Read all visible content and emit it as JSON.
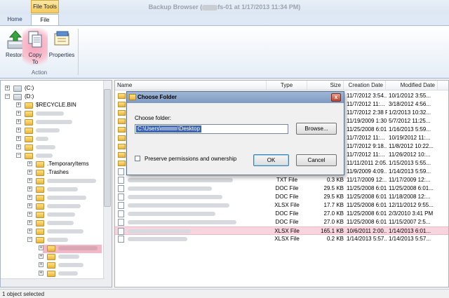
{
  "ribbon": {
    "context_tab": "File Tools",
    "window_title_prefix": "Backup Browser (",
    "window_title_suffix": "fs-01 at 1/17/2013 11:34 PM)",
    "tabs": [
      "Home",
      "File"
    ],
    "buttons": [
      {
        "label": "Restore",
        "icon": "restore-icon"
      },
      {
        "label_line1": "Copy",
        "label_line2": "To",
        "icon": "copy-to-icon"
      },
      {
        "label": "Properties",
        "icon": "properties-icon"
      }
    ],
    "group_label": "Action"
  },
  "tree": {
    "items": [
      {
        "label": "(C:)"
      },
      {
        "label": "(D:)"
      },
      {
        "label": "$RECYCLE.BIN"
      },
      {
        "label": ".TemporaryItems"
      },
      {
        "label": ".Trashes"
      }
    ]
  },
  "list": {
    "columns": [
      "Name",
      "Type",
      "Size",
      "Creation Date",
      "Modified Date"
    ],
    "rows": [
      {
        "type": "",
        "size": "",
        "created": "11/7/2012 3:54...",
        "modified": "10/1/2012 3:55..."
      },
      {
        "type": "",
        "size": "",
        "created": "11/7/2012 11:...",
        "modified": "3/18/2012 4:56..."
      },
      {
        "type": "",
        "size": "",
        "created": "11/7/2012 2:38 PM",
        "modified": "1/2/2013 10:32..."
      },
      {
        "type": "",
        "size": "",
        "created": "11/19/2009 1:30 PM",
        "modified": "5/7/2012 11:25..."
      },
      {
        "type": "",
        "size": "",
        "created": "11/25/2008 6:01...",
        "modified": "1/16/2013 5:59..."
      },
      {
        "type": "",
        "size": "",
        "created": "11/7/2012 11:...",
        "modified": "10/19/2012 11:..."
      },
      {
        "type": "",
        "size": "",
        "created": "11/7/2012 9:18...",
        "modified": "11/8/2012 10:22..."
      },
      {
        "type": "",
        "size": "",
        "created": "11/7/2012 11:...",
        "modified": "11/26/2012 10:..."
      },
      {
        "type": "",
        "size": "",
        "created": "11/11/2011 2:05...",
        "modified": "1/15/2013 5:55..."
      },
      {
        "type": "TXT File",
        "size": "1.5 KB",
        "created": "11/9/2009 4:09...",
        "modified": "1/14/2013 5:59..."
      },
      {
        "type": "TXT File",
        "size": "0.3 KB",
        "created": "11/17/2009 12:...",
        "modified": "11/17/2009 12:..."
      },
      {
        "type": "DOC File",
        "size": "29.5 KB",
        "created": "11/25/2008 6:01...",
        "modified": "11/25/2008 6:01..."
      },
      {
        "type": "DOC File",
        "size": "29.5 KB",
        "created": "11/25/2008 6:01...",
        "modified": "11/18/2008 12:..."
      },
      {
        "type": "XLSX File",
        "size": "17.7 KB",
        "created": "11/25/2008 6:01...",
        "modified": "12/11/2012 9:55..."
      },
      {
        "type": "DOC File",
        "size": "27.0 KB",
        "created": "11/25/2008 6:01...",
        "modified": "2/3/2010 3:41 PM"
      },
      {
        "type": "DOC File",
        "size": "27.0 KB",
        "created": "11/25/2008 6:01...",
        "modified": "11/15/2007 2:5..."
      },
      {
        "type": "XLSX File",
        "size": "165.1 KB",
        "created": "10/6/2011 2:00...",
        "modified": "1/14/2013 6:01..."
      },
      {
        "type": "XLSX File",
        "size": "0.2 KB",
        "created": "1/14/2013 5:57...",
        "modified": "1/14/2013 5:57..."
      }
    ]
  },
  "dialog": {
    "title": "Choose Folder",
    "label": "Choose folder:",
    "path_prefix": "C:\\Users\\",
    "path_suffix": "\\Desktop",
    "browse_label": "Browse...",
    "checkbox_label": "Preserve permissions and ownership",
    "ok_label": "OK",
    "cancel_label": "Cancel",
    "close_glyph": "x"
  },
  "status": {
    "text": "1 object selected"
  }
}
